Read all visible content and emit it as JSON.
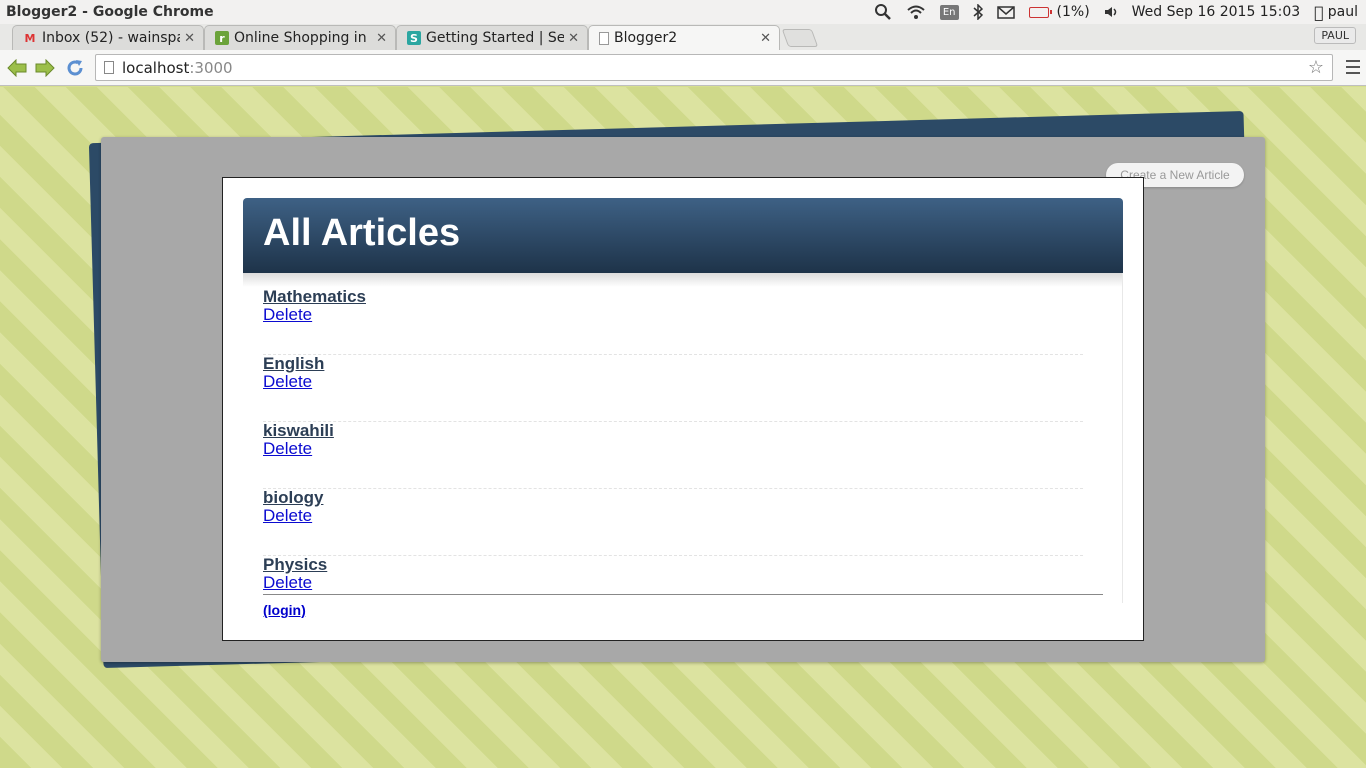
{
  "os": {
    "window_title": "Blogger2 - Google Chrome",
    "keyboard": "En",
    "battery": "(1%)",
    "datetime": "Wed Sep 16 2015 15:03",
    "user": "paul"
  },
  "browser": {
    "tabs": [
      {
        "label": "Inbox (52) - wainspa",
        "icon": "gmail-icon"
      },
      {
        "label": "Online Shopping in I",
        "icon": "r-site-icon"
      },
      {
        "label": "Getting Started | Ser",
        "icon": "s-site-icon"
      },
      {
        "label": "Blogger2",
        "icon": "page-icon"
      }
    ],
    "profile": "PAUL",
    "url_host": "localhost",
    "url_port": ":3000"
  },
  "page": {
    "create_button": "Create a New Article",
    "heading": "All Articles",
    "articles": [
      {
        "title": "Mathematics",
        "delete": "Delete"
      },
      {
        "title": "English",
        "delete": "Delete"
      },
      {
        "title": "kiswahili",
        "delete": "Delete"
      },
      {
        "title": "biology",
        "delete": "Delete"
      },
      {
        "title": "Physics",
        "delete": "Delete"
      }
    ],
    "login_link": "(login)"
  }
}
